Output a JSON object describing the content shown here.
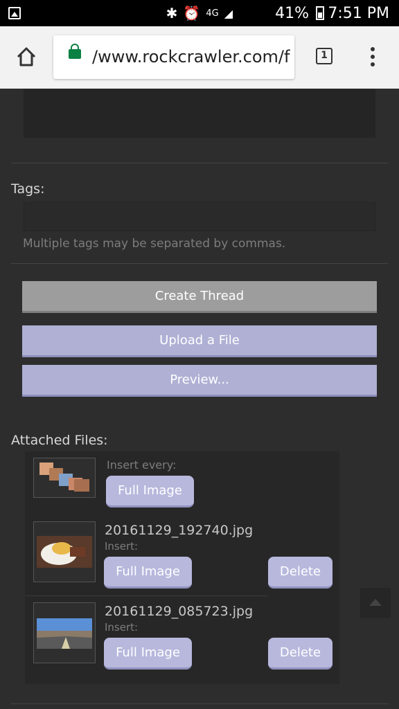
{
  "status_bar": {
    "icons": [
      "gallery-icon",
      "bluetooth-icon",
      "alarm-icon",
      "4g-icon",
      "signal-icon",
      "battery-icon"
    ],
    "lte_label": "4G",
    "battery": "41%",
    "time": "7:51 PM"
  },
  "browser": {
    "url": "/www.rockcrawler.com/f",
    "tab_count": "1"
  },
  "form": {
    "tags_label": "Tags:",
    "tags_value": "",
    "tags_hint": "Multiple tags may be separated by commas.",
    "create_thread": "Create Thread",
    "upload_file": "Upload a File",
    "preview": "Preview..."
  },
  "attachments": {
    "label": "Attached Files:",
    "insert_every": "Insert every:",
    "full_image_all": "Full Image",
    "items": [
      {
        "name": "20161129_192740.jpg",
        "insert": "Insert:",
        "full_image": "Full Image",
        "delete": "Delete"
      },
      {
        "name": "20161129_085723.jpg",
        "insert": "Insert:",
        "full_image": "Full Image",
        "delete": "Delete"
      }
    ]
  },
  "colors": {
    "background": "#2d2d2d",
    "button_gray": "#9d9d9d",
    "button_lavender": "#afb0d4",
    "lock_green": "#0b8043"
  }
}
